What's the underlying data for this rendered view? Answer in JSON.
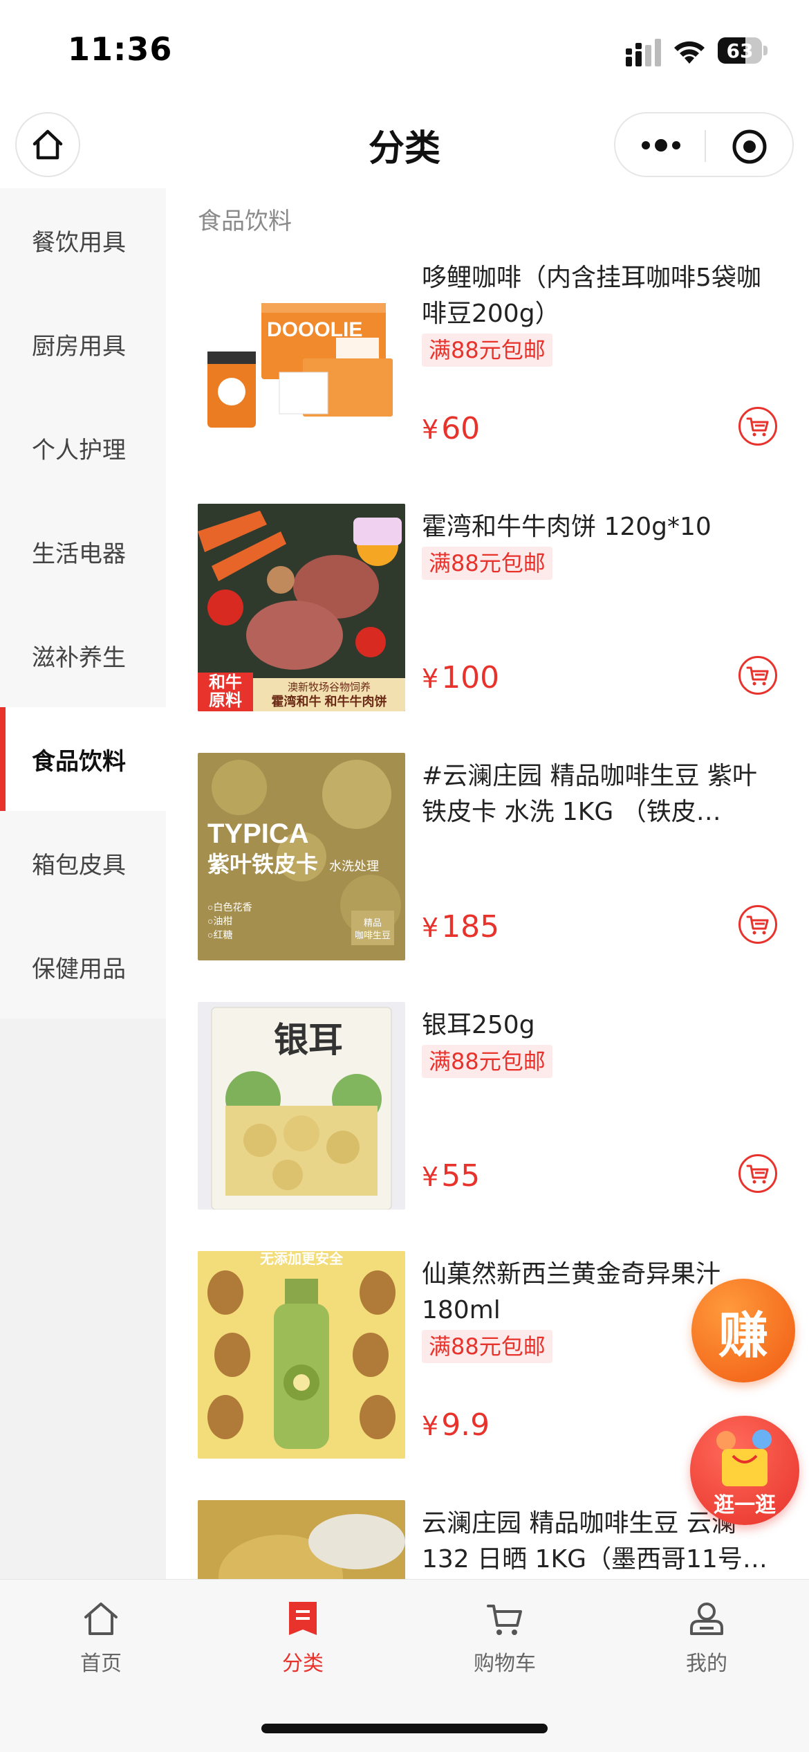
{
  "status_bar": {
    "time": "11:36",
    "battery": "63",
    "battery_level": 0.63
  },
  "nav": {
    "title": "分类"
  },
  "sidebar": {
    "items": [
      {
        "label": "餐饮用具"
      },
      {
        "label": "厨房用具"
      },
      {
        "label": "个人护理"
      },
      {
        "label": "生活电器"
      },
      {
        "label": "滋补养生"
      },
      {
        "label": "食品饮料"
      },
      {
        "label": "箱包皮具"
      },
      {
        "label": "保健用品"
      }
    ],
    "active_index": 5
  },
  "content": {
    "section_title": "食品饮料",
    "products": [
      {
        "name": "哆鲤咖啡（内含挂耳咖啡5袋咖啡豆200g）",
        "tag": "满88元包邮",
        "currency": "¥",
        "price": "60"
      },
      {
        "name": "霍湾和牛牛肉饼 120g*10",
        "tag": "满88元包邮",
        "currency": "¥",
        "price": "100"
      },
      {
        "name": "#云澜庄园 精品咖啡生豆 紫叶铁皮卡 水洗 1KG （铁皮…",
        "tag": "",
        "currency": "¥",
        "price": "185"
      },
      {
        "name": "银耳250g",
        "tag": "满88元包邮",
        "currency": "¥",
        "price": "55"
      },
      {
        "name": "仙菓然新西兰黄金奇异果汁180ml",
        "tag": "满88元包邮",
        "currency": "¥",
        "price": "9.9"
      },
      {
        "name": "云澜庄园 精品咖啡生豆 云澜132 日晒 1KG（墨西哥11号…",
        "tag": "",
        "currency": "¥",
        "price": ""
      }
    ],
    "image_texts": {
      "p0_brand": "DOOOLIE",
      "p1_badge": "和牛\n原料",
      "p1_caption": "澳新牧场谷物饲养",
      "p1_caption2": "霍湾和牛 和牛牛肉饼",
      "p2_title": "TYPICA",
      "p2_sub": "紫叶铁皮卡",
      "p2_sub2": "水洗处理",
      "p2_notes": "○白色花香\n○油柑\n○红糖",
      "p2_badge": "精品\n咖啡生豆",
      "p3_title": "银耳",
      "p4_top": "无添加更安全"
    }
  },
  "floating": {
    "earn_label": "赚",
    "shop_label": "逛一逛"
  },
  "tab_bar": {
    "tabs": [
      {
        "label": "首页",
        "icon": "home-icon"
      },
      {
        "label": "分类",
        "icon": "category-icon"
      },
      {
        "label": "购物车",
        "icon": "cart-icon"
      },
      {
        "label": "我的",
        "icon": "profile-icon"
      }
    ],
    "active_index": 1
  },
  "colors": {
    "accent": "#e8322c",
    "sidebar_bg": "#f2f2f2",
    "earn": "#f05a12"
  }
}
